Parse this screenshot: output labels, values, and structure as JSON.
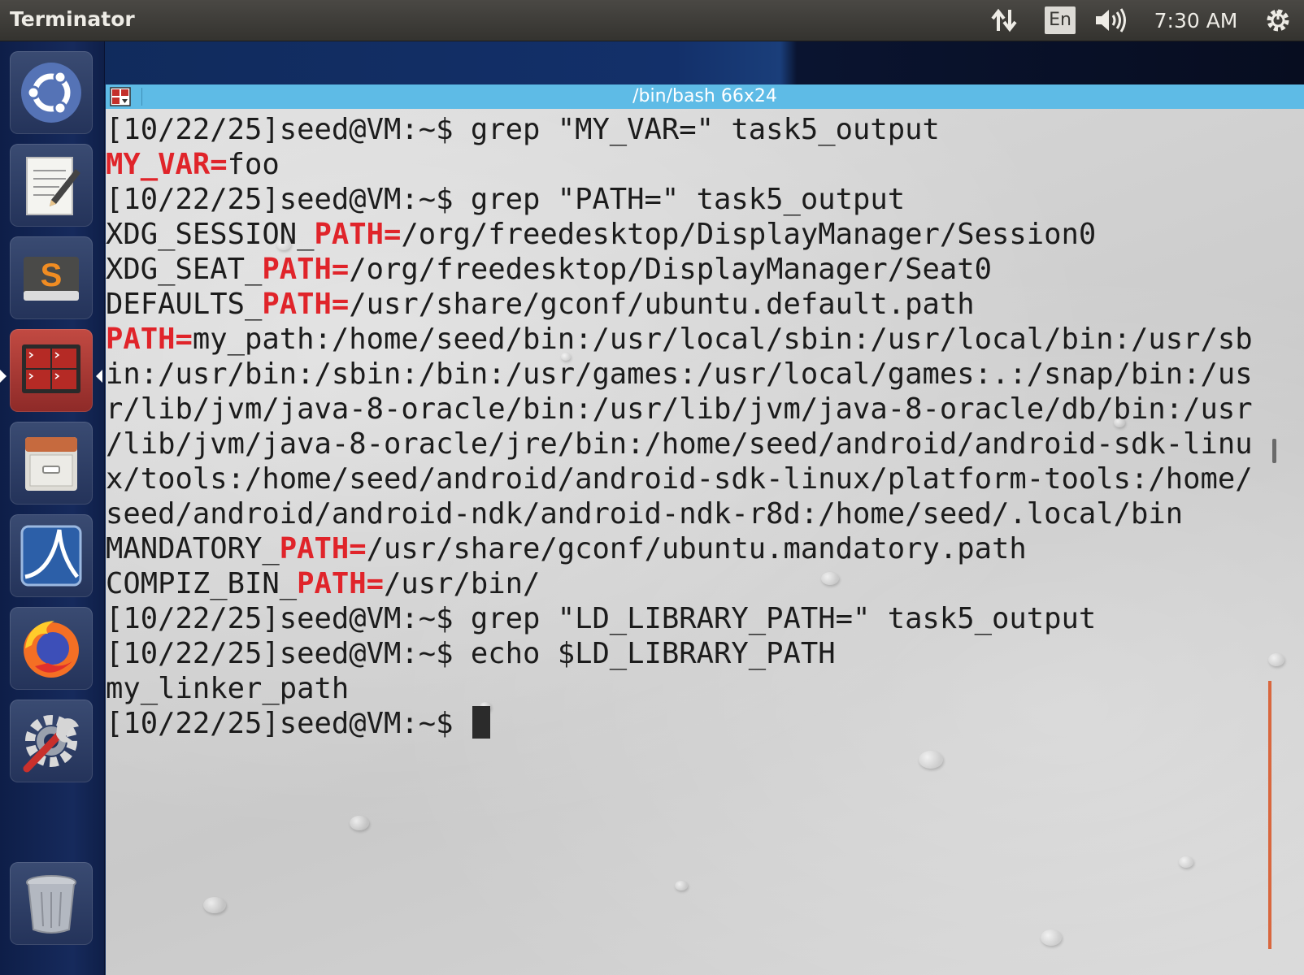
{
  "top_panel": {
    "app_title": "Terminator",
    "network_icon": "network-updown-icon",
    "keyboard_layout": "En",
    "volume_icon": "volume-icon",
    "clock": "7:30 AM",
    "power_icon": "power-gear-icon"
  },
  "launcher": {
    "items": [
      {
        "name": "ubuntu-dash",
        "icon": "ubuntu-logo-icon"
      },
      {
        "name": "text-editor",
        "icon": "text-editor-icon"
      },
      {
        "name": "sublime-text",
        "icon": "sublime-text-icon"
      },
      {
        "name": "terminator",
        "icon": "terminator-icon",
        "active": true
      },
      {
        "name": "files",
        "icon": "file-cabinet-icon"
      },
      {
        "name": "wireshark",
        "icon": "wireshark-icon"
      },
      {
        "name": "firefox",
        "icon": "firefox-icon"
      },
      {
        "name": "system-settings",
        "icon": "settings-wrench-icon"
      },
      {
        "name": "trash",
        "icon": "trash-icon"
      }
    ]
  },
  "terminal": {
    "title": "/bin/bash 66x24",
    "lines": [
      {
        "segments": [
          {
            "text": "[10/22/25]seed@VM:~$ grep \"MY_VAR=\" task5_output"
          }
        ]
      },
      {
        "segments": [
          {
            "text": "MY_VAR=",
            "hl": true
          },
          {
            "text": "foo"
          }
        ]
      },
      {
        "segments": [
          {
            "text": "[10/22/25]seed@VM:~$ grep \"PATH=\" task5_output"
          }
        ]
      },
      {
        "segments": [
          {
            "text": "XDG_SESSION_"
          },
          {
            "text": "PATH=",
            "hl": true
          },
          {
            "text": "/org/freedesktop/DisplayManager/Session0"
          }
        ]
      },
      {
        "segments": [
          {
            "text": "XDG_SEAT_"
          },
          {
            "text": "PATH=",
            "hl": true
          },
          {
            "text": "/org/freedesktop/DisplayManager/Seat0"
          }
        ]
      },
      {
        "segments": [
          {
            "text": "DEFAULTS_"
          },
          {
            "text": "PATH=",
            "hl": true
          },
          {
            "text": "/usr/share/gconf/ubuntu.default.path"
          }
        ]
      },
      {
        "segments": [
          {
            "text": "PATH=",
            "hl": true
          },
          {
            "text": "my_path:/home/seed/bin:/usr/local/sbin:/usr/local/bin:/usr/sb"
          }
        ]
      },
      {
        "segments": [
          {
            "text": "in:/usr/bin:/sbin:/bin:/usr/games:/usr/local/games:.:/snap/bin:/us"
          }
        ]
      },
      {
        "segments": [
          {
            "text": "r/lib/jvm/java-8-oracle/bin:/usr/lib/jvm/java-8-oracle/db/bin:/usr"
          }
        ]
      },
      {
        "segments": [
          {
            "text": "/lib/jvm/java-8-oracle/jre/bin:/home/seed/android/android-sdk-linu"
          }
        ]
      },
      {
        "segments": [
          {
            "text": "x/tools:/home/seed/android/android-sdk-linux/platform-tools:/home/"
          }
        ]
      },
      {
        "segments": [
          {
            "text": "seed/android/android-ndk/android-ndk-r8d:/home/seed/.local/bin"
          }
        ]
      },
      {
        "segments": [
          {
            "text": "MANDATORY_"
          },
          {
            "text": "PATH=",
            "hl": true
          },
          {
            "text": "/usr/share/gconf/ubuntu.mandatory.path"
          }
        ]
      },
      {
        "segments": [
          {
            "text": "COMPIZ_BIN_"
          },
          {
            "text": "PATH=",
            "hl": true
          },
          {
            "text": "/usr/bin/"
          }
        ]
      },
      {
        "segments": [
          {
            "text": "[10/22/25]seed@VM:~$ grep \"LD_LIBRARY_PATH=\" task5_output"
          }
        ]
      },
      {
        "segments": [
          {
            "text": "[10/22/25]seed@VM:~$ echo $LD_LIBRARY_PATH"
          }
        ]
      },
      {
        "segments": [
          {
            "text": "my_linker_path"
          }
        ]
      },
      {
        "segments": [
          {
            "text": "[10/22/25]seed@VM:~$ "
          }
        ],
        "cursor": true
      }
    ]
  },
  "colors": {
    "highlight": "#e0242a",
    "titlebar": "#5ebbe6",
    "terminal_text": "#1c1c1c"
  }
}
